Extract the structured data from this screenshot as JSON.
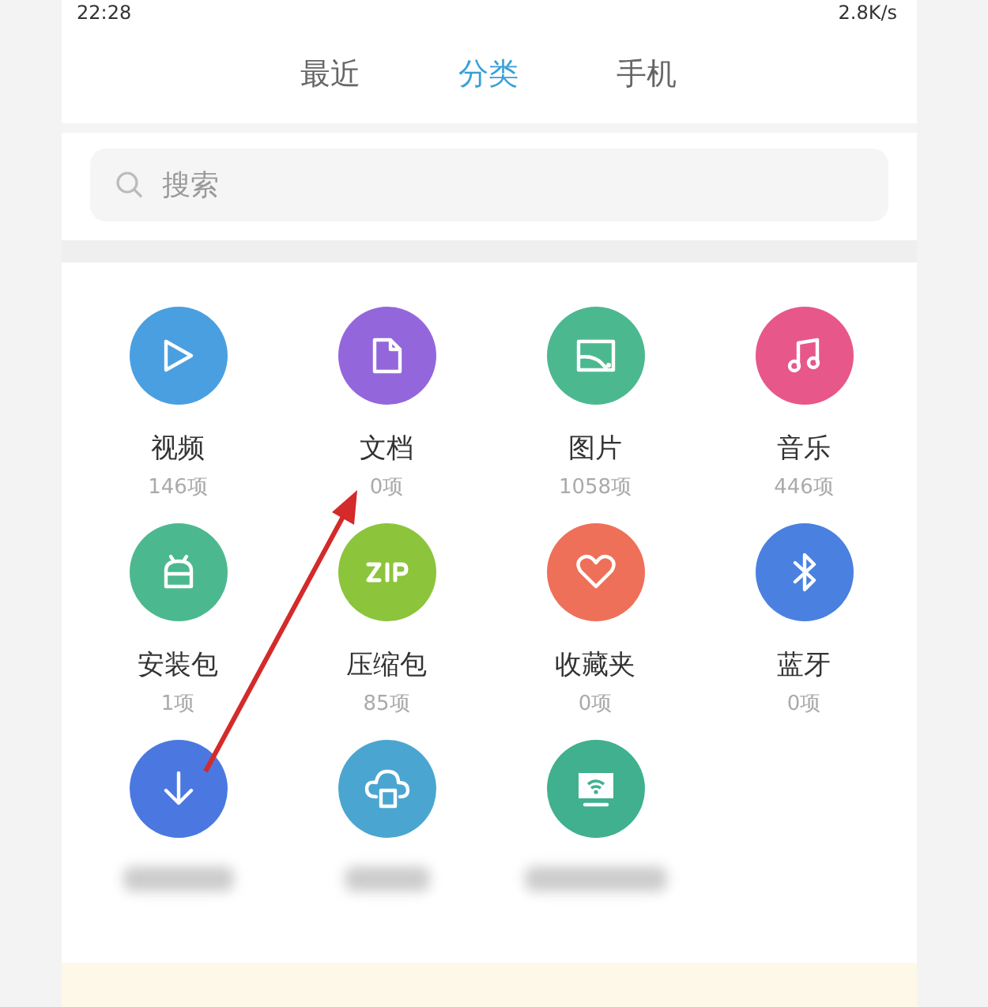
{
  "status_bar": {
    "time": "22:28",
    "speed": "2.8K/s"
  },
  "tabs": [
    {
      "label": "最近",
      "selected": false
    },
    {
      "label": "分类",
      "selected": true
    },
    {
      "label": "手机",
      "selected": false
    }
  ],
  "search": {
    "placeholder": "搜索"
  },
  "categories": [
    {
      "kind": "video",
      "name": "视频",
      "count": "146项",
      "color": "#4a9fe0"
    },
    {
      "kind": "document",
      "name": "文档",
      "count": "0项",
      "color": "#9466db"
    },
    {
      "kind": "image",
      "name": "图片",
      "count": "1058项",
      "color": "#4cb890"
    },
    {
      "kind": "music",
      "name": "音乐",
      "count": "446项",
      "color": "#e8578a"
    },
    {
      "kind": "apk",
      "name": "安装包",
      "count": "1项",
      "color": "#4cb890"
    },
    {
      "kind": "zip",
      "name": "压缩包",
      "count": "85项",
      "color": "#8cc43c"
    },
    {
      "kind": "favorite",
      "name": "收藏夹",
      "count": "0项",
      "color": "#ee7058"
    },
    {
      "kind": "bluetooth",
      "name": "蓝牙",
      "count": "0项",
      "color": "#4a80e0"
    },
    {
      "kind": "download",
      "blurred": true,
      "color": "#4a78e0"
    },
    {
      "kind": "cloud",
      "blurred": true,
      "color": "#4aa6d0"
    },
    {
      "kind": "remote",
      "blurred": true,
      "color": "#40b08e"
    }
  ]
}
